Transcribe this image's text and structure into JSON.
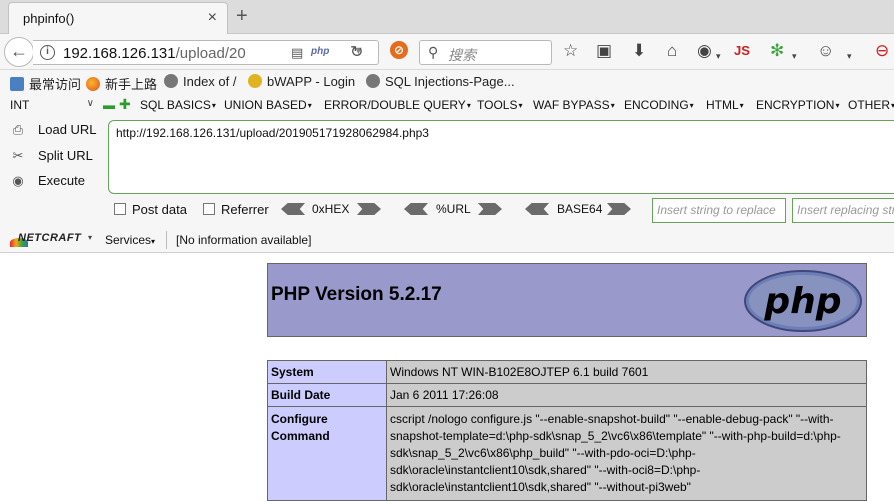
{
  "tab": {
    "title": "phpinfo()"
  },
  "nav": {
    "url_host": "192.168.126.131",
    "url_path": "/upload/20",
    "php_badge": "php",
    "search_placeholder": "搜索",
    "js_label": "JS"
  },
  "bookmarks": [
    {
      "label": "最常访问",
      "icon": "bookmark-folder-icon"
    },
    {
      "label": "新手上路",
      "icon": "firefox-icon"
    },
    {
      "label": "Index of /",
      "icon": "globe-icon"
    },
    {
      "label": "bWAPP - Login",
      "icon": "bee-icon"
    },
    {
      "label": "SQL Injections-Page...",
      "icon": "globe-icon"
    }
  ],
  "hackbar": {
    "select_value": "INT",
    "menus": [
      "SQL BASICS",
      "UNION BASED",
      "ERROR/DOUBLE QUERY",
      "TOOLS",
      "WAF BYPASS",
      "ENCODING",
      "HTML",
      "ENCRYPTION",
      "OTHER"
    ],
    "actions": [
      "Load URL",
      "Split URL",
      "Execute"
    ],
    "url_value": "http://192.168.126.131/upload/201905171928062984.php3",
    "post_data_label": "Post data",
    "referrer_label": "Referrer",
    "encoders": [
      "0xHEX",
      "%URL",
      "BASE64"
    ],
    "insert_placeholder": "Insert string to replace",
    "replacing_placeholder": "Insert replacing string"
  },
  "netcraft": {
    "logo_text": "NETCRAFT",
    "services_label": "Services",
    "info_text": "[No information available]"
  },
  "phpinfo": {
    "title": "PHP Version 5.2.17",
    "logo_text": "php",
    "rows": [
      {
        "key": "System",
        "value": "Windows NT WIN-B102E8OJTEP 6.1 build 7601"
      },
      {
        "key": "Build Date",
        "value": "Jan 6 2011 17:26:08"
      },
      {
        "key": "Configure Command",
        "value": "cscript /nologo configure.js \"--enable-snapshot-build\" \"--enable-debug-pack\" \"--with-snapshot-template=d:\\php-sdk\\snap_5_2\\vc6\\x86\\template\" \"--with-php-build=d:\\php-sdk\\snap_5_2\\vc6\\x86\\php_build\" \"--with-pdo-oci=D:\\php-sdk\\oracle\\instantclient10\\sdk,shared\" \"--with-oci8=D:\\php-sdk\\oracle\\instantclient10\\sdk,shared\" \"--without-pi3web\""
      }
    ]
  },
  "colors": {
    "php_header_bg": "#9999cc",
    "php_key_bg": "#ccccff",
    "php_value_bg": "#cccccc",
    "hackbar_border": "#66a35a"
  }
}
